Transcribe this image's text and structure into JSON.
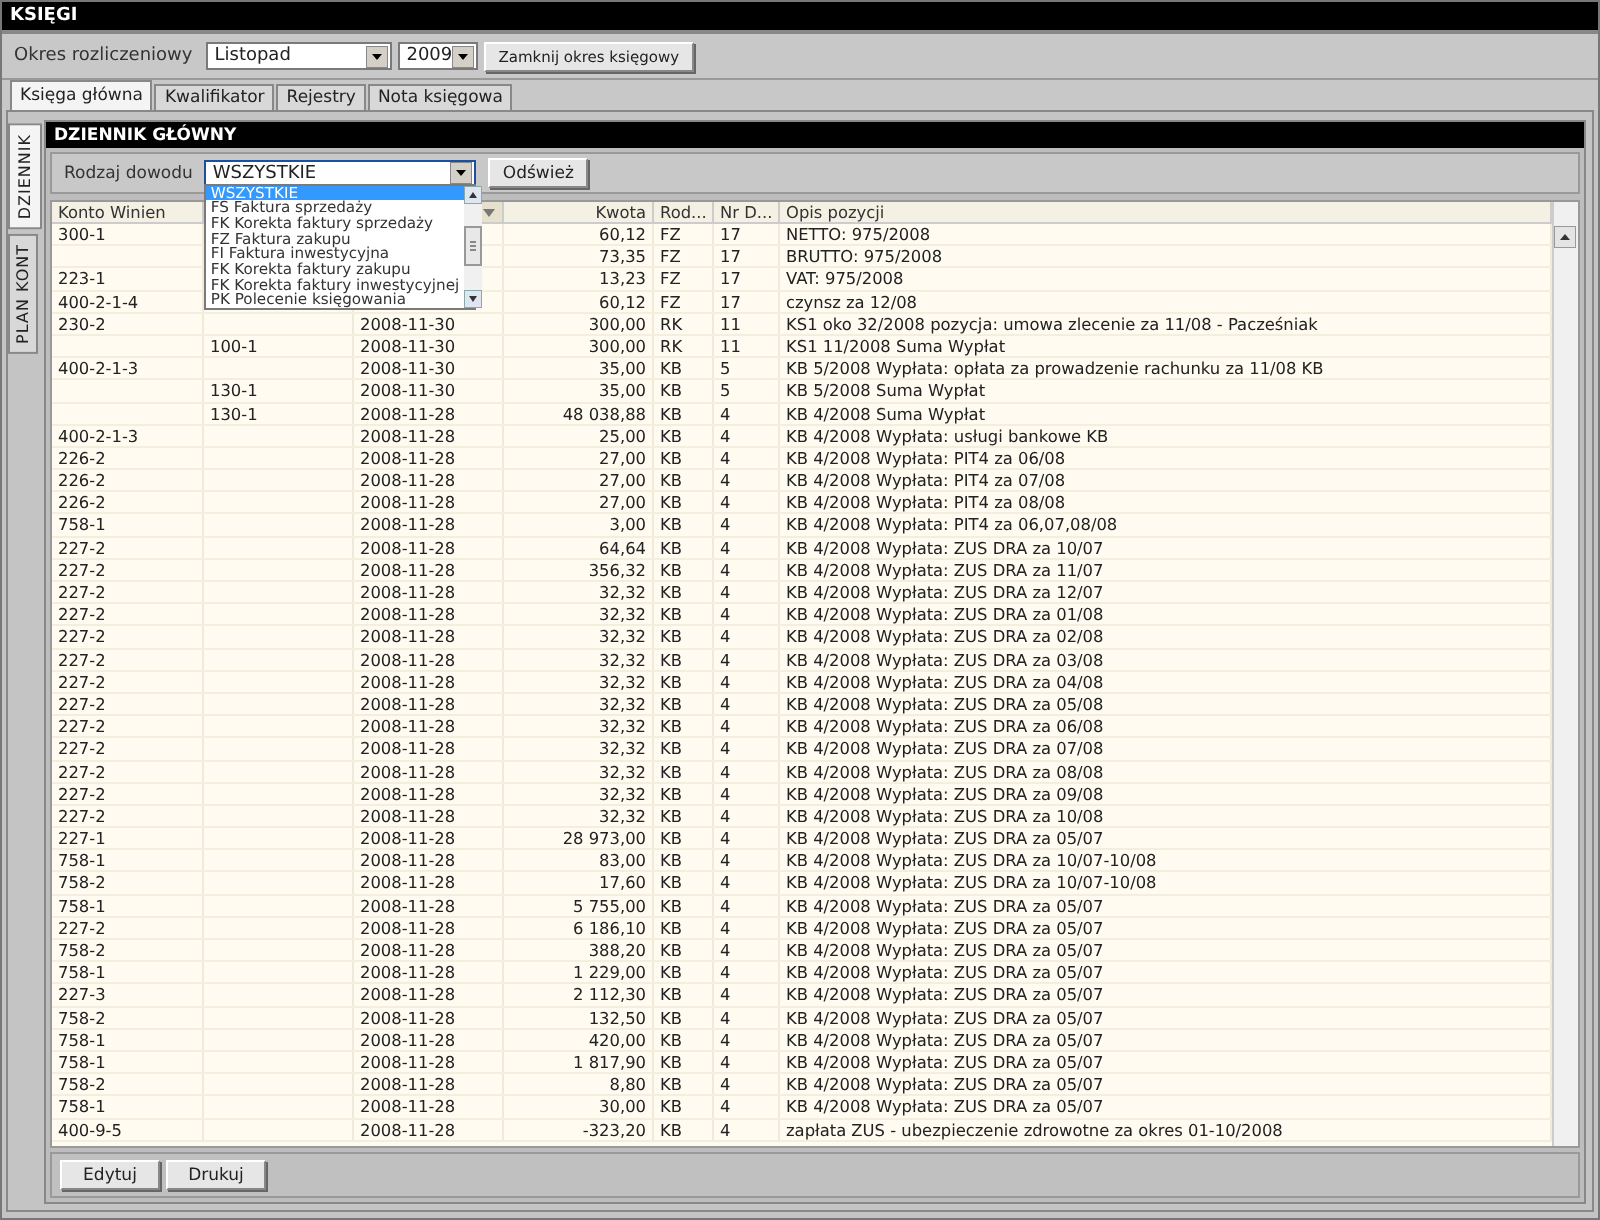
{
  "window": {
    "title": "KSIĘGI"
  },
  "period": {
    "label": "Okres rozliczeniowy",
    "month": "Listopad",
    "year": "2009",
    "close_button": "Zamknij okres księgowy"
  },
  "tabs": [
    {
      "label": "Księga główna",
      "selected": true
    },
    {
      "label": "Kwalifikator",
      "selected": false
    },
    {
      "label": "Rejestry",
      "selected": false
    },
    {
      "label": "Nota księgowa",
      "selected": false
    }
  ],
  "side_tabs": [
    {
      "label": "DZIENNIK",
      "selected": true
    },
    {
      "label": "PLAN KONT",
      "selected": false
    }
  ],
  "panel": {
    "title": "DZIENNIK GŁÓWNY"
  },
  "filter": {
    "label": "Rodzaj dowodu",
    "value": "WSZYSTKIE",
    "open": true,
    "refresh_button": "Odśwież",
    "options": [
      {
        "label": "WSZYSTKIE",
        "selected": true
      },
      {
        "label": "FS Faktura sprzedaży",
        "selected": false
      },
      {
        "label": "FK Korekta faktury sprzedaży",
        "selected": false
      },
      {
        "label": "FZ Faktura zakupu",
        "selected": false
      },
      {
        "label": "FI Faktura inwestycyjna",
        "selected": false
      },
      {
        "label": "FK Korekta faktury zakupu",
        "selected": false
      },
      {
        "label": "FK Korekta faktury inwestycyjnej",
        "selected": false
      },
      {
        "label": "PK Polecenie księgowania",
        "selected": false
      }
    ]
  },
  "table": {
    "columns": [
      {
        "label": "Konto Winien",
        "sorted": false
      },
      {},
      {
        "sorted": true
      },
      {
        "label": "Kwota",
        "sorted": false
      },
      {
        "label": "Rod...",
        "sorted": false
      },
      {
        "label": "Nr D...",
        "sorted": false
      },
      {
        "label": "Opis pozycji",
        "sorted": false
      }
    ],
    "rows": [
      {
        "cells": {
          "0": "300-1",
          "3": "60,12",
          "4": "FZ",
          "5": "17",
          "6": "NETTO: 975/2008"
        }
      },
      {
        "cells": {
          "3": "73,35",
          "4": "FZ",
          "5": "17",
          "6": "BRUTTO: 975/2008"
        }
      },
      {
        "cells": {
          "0": "223-1",
          "3": "13,23",
          "4": "FZ",
          "5": "17",
          "6": "VAT: 975/2008"
        }
      },
      {
        "cells": {
          "0": "400-2-1-4",
          "3": "60,12",
          "4": "FZ",
          "5": "17",
          "6": "czynsz za 12/08"
        }
      },
      {
        "cells": {
          "0": "230-2",
          "2": "2008-11-30",
          "3": "300,00",
          "4": "RK",
          "5": "11",
          "6": "KS1 oko 32/2008 pozycja: umowa zlecenie za 11/08 - Pacześniak"
        }
      },
      {
        "cells": {
          "1": "100-1",
          "2": "2008-11-30",
          "3": "300,00",
          "4": "RK",
          "5": "11",
          "6": "KS1 11/2008 Suma Wypłat"
        }
      },
      {
        "cells": {
          "0": "400-2-1-3",
          "2": "2008-11-30",
          "3": "35,00",
          "4": "KB",
          "5": "5",
          "6": "KB 5/2008 Wypłata: opłata za prowadzenie rachunku za 11/08 KB"
        }
      },
      {
        "cells": {
          "1": "130-1",
          "2": "2008-11-30",
          "3": "35,00",
          "4": "KB",
          "5": "5",
          "6": "KB 5/2008 Suma Wypłat"
        }
      },
      {
        "cells": {
          "1": "130-1",
          "2": "2008-11-28",
          "3": "48 038,88",
          "4": "KB",
          "5": "4",
          "6": "KB 4/2008 Suma Wypłat"
        }
      },
      {
        "cells": {
          "0": "400-2-1-3",
          "2": "2008-11-28",
          "3": "25,00",
          "4": "KB",
          "5": "4",
          "6": "KB 4/2008 Wypłata: usługi bankowe KB"
        }
      },
      {
        "cells": {
          "0": "226-2",
          "2": "2008-11-28",
          "3": "27,00",
          "4": "KB",
          "5": "4",
          "6": "KB 4/2008 Wypłata: PIT4 za 06/08"
        }
      },
      {
        "cells": {
          "0": "226-2",
          "2": "2008-11-28",
          "3": "27,00",
          "4": "KB",
          "5": "4",
          "6": "KB 4/2008 Wypłata: PIT4 za 07/08"
        }
      },
      {
        "cells": {
          "0": "226-2",
          "2": "2008-11-28",
          "3": "27,00",
          "4": "KB",
          "5": "4",
          "6": "KB 4/2008 Wypłata: PIT4 za 08/08"
        }
      },
      {
        "cells": {
          "0": "758-1",
          "2": "2008-11-28",
          "3": "3,00",
          "4": "KB",
          "5": "4",
          "6": "KB 4/2008 Wypłata: PIT4 za 06,07,08/08"
        }
      },
      {
        "cells": {
          "0": "227-2",
          "2": "2008-11-28",
          "3": "64,64",
          "4": "KB",
          "5": "4",
          "6": "KB 4/2008 Wypłata: ZUS DRA za 10/07"
        }
      },
      {
        "cells": {
          "0": "227-2",
          "2": "2008-11-28",
          "3": "356,32",
          "4": "KB",
          "5": "4",
          "6": "KB 4/2008 Wypłata: ZUS DRA za 11/07"
        }
      },
      {
        "cells": {
          "0": "227-2",
          "2": "2008-11-28",
          "3": "32,32",
          "4": "KB",
          "5": "4",
          "6": "KB 4/2008 Wypłata: ZUS DRA za 12/07"
        }
      },
      {
        "cells": {
          "0": "227-2",
          "2": "2008-11-28",
          "3": "32,32",
          "4": "KB",
          "5": "4",
          "6": "KB 4/2008 Wypłata: ZUS DRA za 01/08"
        }
      },
      {
        "cells": {
          "0": "227-2",
          "2": "2008-11-28",
          "3": "32,32",
          "4": "KB",
          "5": "4",
          "6": "KB 4/2008 Wypłata: ZUS DRA za 02/08"
        }
      },
      {
        "cells": {
          "0": "227-2",
          "2": "2008-11-28",
          "3": "32,32",
          "4": "KB",
          "5": "4",
          "6": "KB 4/2008 Wypłata: ZUS DRA za 03/08"
        }
      },
      {
        "cells": {
          "0": "227-2",
          "2": "2008-11-28",
          "3": "32,32",
          "4": "KB",
          "5": "4",
          "6": "KB 4/2008 Wypłata: ZUS DRA za 04/08"
        }
      },
      {
        "cells": {
          "0": "227-2",
          "2": "2008-11-28",
          "3": "32,32",
          "4": "KB",
          "5": "4",
          "6": "KB 4/2008 Wypłata: ZUS DRA za 05/08"
        }
      },
      {
        "cells": {
          "0": "227-2",
          "2": "2008-11-28",
          "3": "32,32",
          "4": "KB",
          "5": "4",
          "6": "KB 4/2008 Wypłata: ZUS DRA za 06/08"
        }
      },
      {
        "cells": {
          "0": "227-2",
          "2": "2008-11-28",
          "3": "32,32",
          "4": "KB",
          "5": "4",
          "6": "KB 4/2008 Wypłata: ZUS DRA za 07/08"
        }
      },
      {
        "cells": {
          "0": "227-2",
          "2": "2008-11-28",
          "3": "32,32",
          "4": "KB",
          "5": "4",
          "6": "KB 4/2008 Wypłata: ZUS DRA za 08/08"
        }
      },
      {
        "cells": {
          "0": "227-2",
          "2": "2008-11-28",
          "3": "32,32",
          "4": "KB",
          "5": "4",
          "6": "KB 4/2008 Wypłata: ZUS DRA za 09/08"
        }
      },
      {
        "cells": {
          "0": "227-2",
          "2": "2008-11-28",
          "3": "32,32",
          "4": "KB",
          "5": "4",
          "6": "KB 4/2008 Wypłata: ZUS DRA za 10/08"
        }
      },
      {
        "cells": {
          "0": "227-1",
          "2": "2008-11-28",
          "3": "28 973,00",
          "4": "KB",
          "5": "4",
          "6": "KB 4/2008 Wypłata: ZUS DRA za 05/07"
        }
      },
      {
        "cells": {
          "0": "758-1",
          "2": "2008-11-28",
          "3": "83,00",
          "4": "KB",
          "5": "4",
          "6": "KB 4/2008 Wypłata: ZUS DRA za 10/07-10/08"
        }
      },
      {
        "cells": {
          "0": "758-2",
          "2": "2008-11-28",
          "3": "17,60",
          "4": "KB",
          "5": "4",
          "6": "KB 4/2008 Wypłata: ZUS DRA za 10/07-10/08"
        }
      },
      {
        "cells": {
          "0": "758-1",
          "2": "2008-11-28",
          "3": "5 755,00",
          "4": "KB",
          "5": "4",
          "6": "KB 4/2008 Wypłata: ZUS DRA za 05/07"
        }
      },
      {
        "cells": {
          "0": "227-2",
          "2": "2008-11-28",
          "3": "6 186,10",
          "4": "KB",
          "5": "4",
          "6": "KB 4/2008 Wypłata: ZUS DRA za 05/07"
        }
      },
      {
        "cells": {
          "0": "758-2",
          "2": "2008-11-28",
          "3": "388,20",
          "4": "KB",
          "5": "4",
          "6": "KB 4/2008 Wypłata: ZUS DRA za 05/07"
        }
      },
      {
        "cells": {
          "0": "758-1",
          "2": "2008-11-28",
          "3": "1 229,00",
          "4": "KB",
          "5": "4",
          "6": "KB 4/2008 Wypłata: ZUS DRA za 05/07"
        }
      },
      {
        "cells": {
          "0": "227-3",
          "2": "2008-11-28",
          "3": "2 112,30",
          "4": "KB",
          "5": "4",
          "6": "KB 4/2008 Wypłata: ZUS DRA za 05/07"
        }
      },
      {
        "cells": {
          "0": "758-2",
          "2": "2008-11-28",
          "3": "132,50",
          "4": "KB",
          "5": "4",
          "6": "KB 4/2008 Wypłata: ZUS DRA za 05/07"
        }
      },
      {
        "cells": {
          "0": "758-1",
          "2": "2008-11-28",
          "3": "420,00",
          "4": "KB",
          "5": "4",
          "6": "KB 4/2008 Wypłata: ZUS DRA za 05/07"
        }
      },
      {
        "cells": {
          "0": "758-1",
          "2": "2008-11-28",
          "3": "1 817,90",
          "4": "KB",
          "5": "4",
          "6": "KB 4/2008 Wypłata: ZUS DRA za 05/07"
        }
      },
      {
        "cells": {
          "0": "758-2",
          "2": "2008-11-28",
          "3": "8,80",
          "4": "KB",
          "5": "4",
          "6": "KB 4/2008 Wypłata: ZUS DRA za 05/07"
        }
      },
      {
        "cells": {
          "0": "758-1",
          "2": "2008-11-28",
          "3": "30,00",
          "4": "KB",
          "5": "4",
          "6": "KB 4/2008 Wypłata: ZUS DRA za 05/07"
        }
      },
      {
        "cells": {
          "0": "400-9-5",
          "2": "2008-11-28",
          "3": "-323,20",
          "4": "KB",
          "5": "4",
          "6": "zapłata ZUS - ubezpieczenie zdrowotne za okres 01-10/2008"
        }
      }
    ]
  },
  "buttons": [
    "Edytuj",
    "Drukuj"
  ]
}
